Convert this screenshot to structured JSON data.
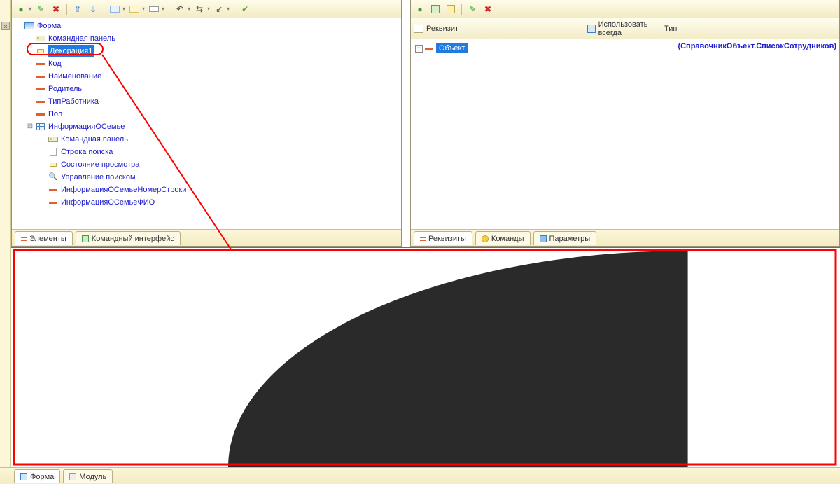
{
  "left_toolbar": {
    "add": "＋",
    "edit": "✎",
    "del": "✖",
    "up": "⬆",
    "down": "⬇",
    "group": "▭",
    "splitter": "▢",
    "field": "▭",
    "swap1": "↺",
    "swap2": "⇄",
    "swap3": "↙",
    "check": "✔"
  },
  "tree": {
    "root": "Форма",
    "cmdpanel": "Командная панель",
    "decoration": "Декорация1",
    "fields": [
      "Код",
      "Наименование",
      "Родитель",
      "ТипРаботника",
      "Пол"
    ],
    "table": "ИнформацияОСемье",
    "table_children": {
      "cmdpanel": "Командная панель",
      "search": "Строка поиска",
      "state": "Состояние просмотра",
      "findctl": "Управление поиском",
      "col1": "ИнформацияОСемьеНомерСтроки",
      "col2": "ИнформацияОСемьеФИО"
    }
  },
  "left_tabs": {
    "elements": "Элементы",
    "cmdiface": "Командный интерфейс"
  },
  "right_toolbar": {
    "add": "＋",
    "addg": "▦",
    "ins": "▤",
    "edit": "✎",
    "del": "✖"
  },
  "right_header": {
    "c1": "Реквизит",
    "c2": "Использовать всегда",
    "c3": "Тип"
  },
  "right_body": {
    "object": "Объект",
    "type": "(СправочникОбъект.СписокСотрудников)"
  },
  "right_tabs": {
    "props": "Реквизиты",
    "cmds": "Команды",
    "params": "Параметры"
  },
  "app_tabs": {
    "form": "Форма",
    "module": "Модуль"
  }
}
